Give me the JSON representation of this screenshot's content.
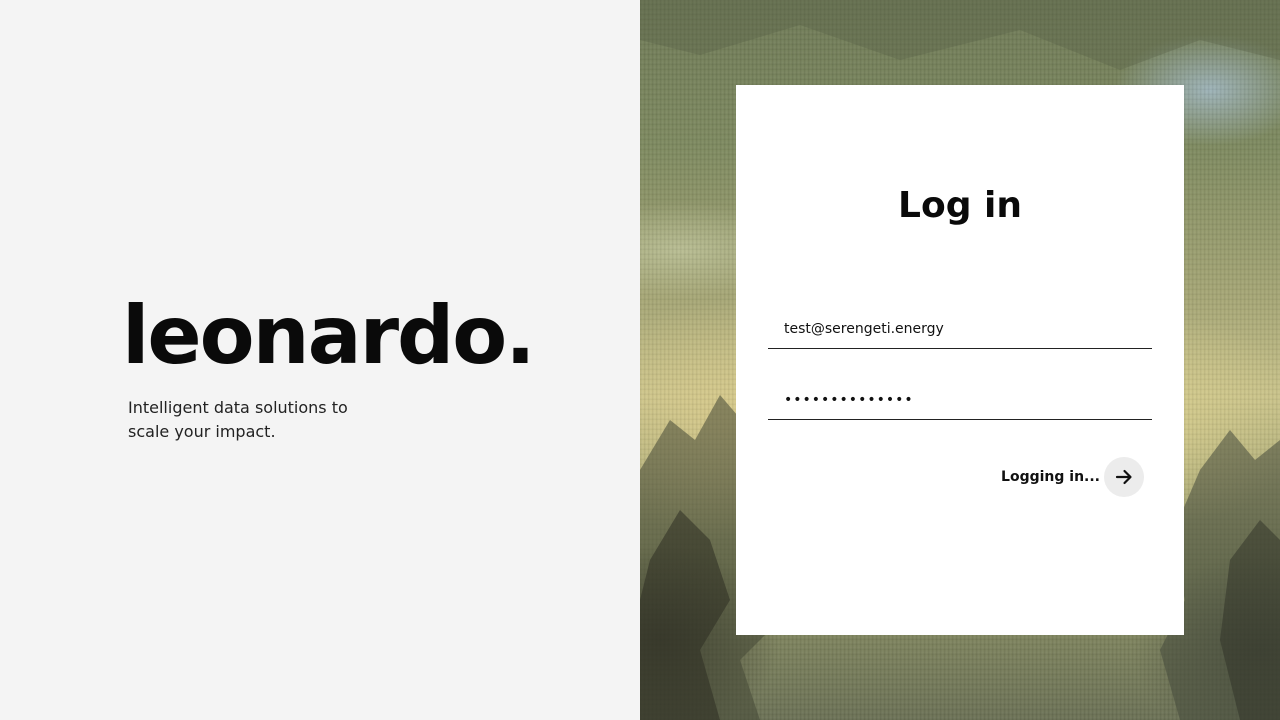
{
  "brand": {
    "name": "leonardo.",
    "tagline": "Intelligent data solutions to scale your impact."
  },
  "login": {
    "title": "Log in",
    "email_value": "test@serengeti.energy",
    "password_value": "••••••••••••••",
    "submit_label": "Logging in...",
    "submit_icon": "arrow-right-icon"
  },
  "colors": {
    "left_background": "#f4f4f4",
    "card_background": "#ffffff",
    "text": "#0a0a0a",
    "submit_circle": "#ececec"
  }
}
